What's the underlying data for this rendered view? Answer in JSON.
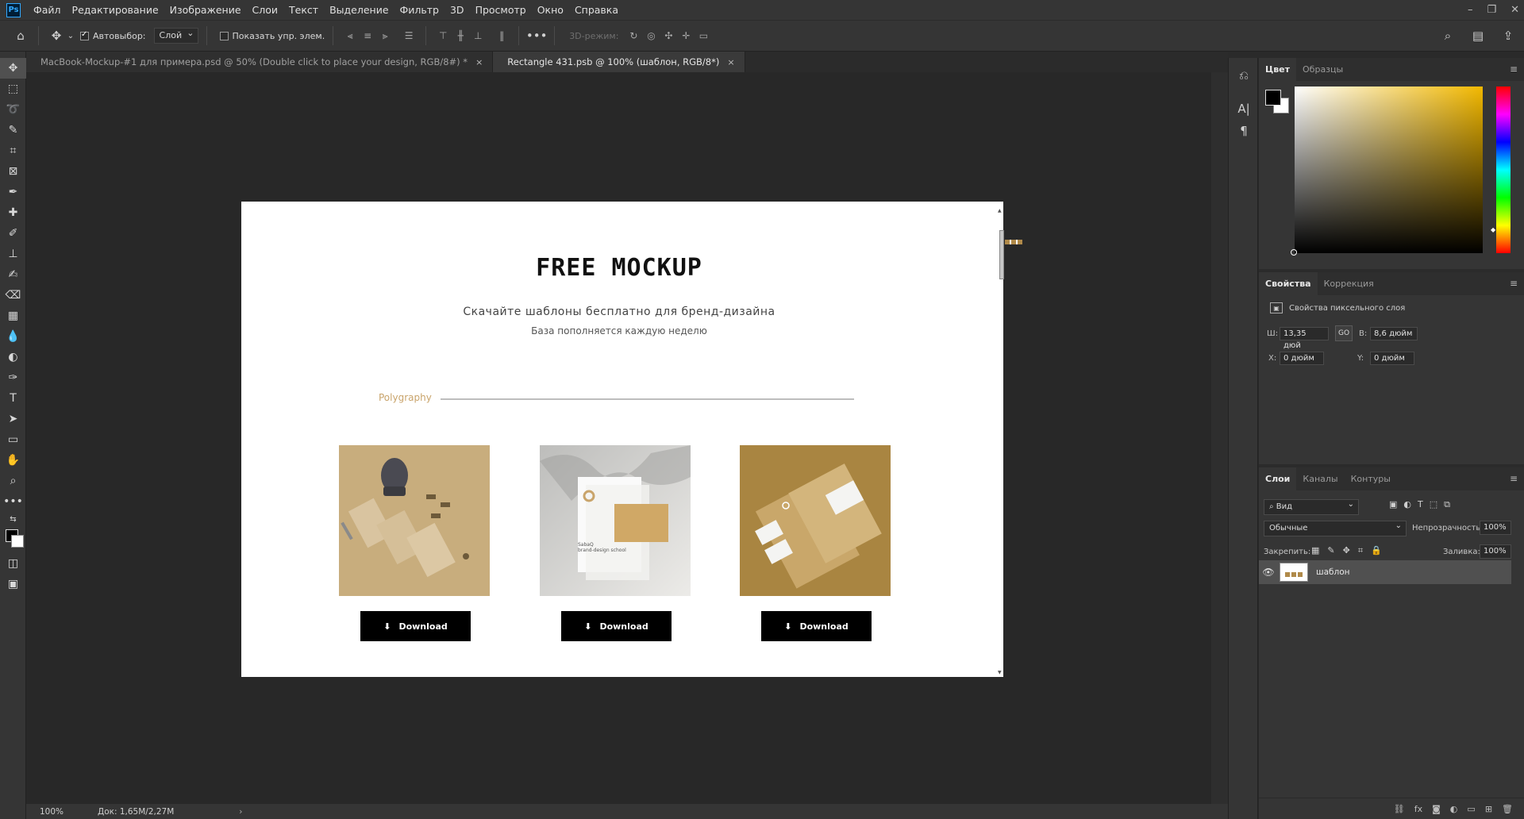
{
  "app": {
    "logo": "Ps"
  },
  "menu": [
    "Файл",
    "Редактирование",
    "Изображение",
    "Слои",
    "Текст",
    "Выделение",
    "Фильтр",
    "3D",
    "Просмотр",
    "Окно",
    "Справка"
  ],
  "options": {
    "auto_select_label": "Автовыбор:",
    "layer_select": "Слой",
    "show_transform_label": "Показать упр. элем.",
    "more": "•••",
    "mode3d": "3D-режим:"
  },
  "tabs": [
    {
      "label": "MacBook-Mockup-#1 для примера.psd @ 50% (Double click to place your design, RGB/8#) *",
      "close": "×"
    },
    {
      "label": "Rectangle 431.psb @ 100% (шаблон, RGB/8*)",
      "close": "×"
    }
  ],
  "status": {
    "zoom": "100%",
    "doc": "Док: 1,65M/2,27M",
    "arrow": "›"
  },
  "document": {
    "title": "FREE MOCKUP",
    "subtitle": "Скачайте шаблоны бесплатно для бренд-дизайна",
    "subtitle2": "База пополняется каждую неделю",
    "category": "Polygraphy",
    "card2_text": "SabaQ\nbrand-design school",
    "download_label": "Download"
  },
  "color_panel": {
    "tabs": [
      "Цвет",
      "Образцы"
    ],
    "menu": "≡"
  },
  "properties_panel": {
    "tabs": [
      "Свойства",
      "Коррекция"
    ],
    "title": "Свойства пиксельного слоя",
    "w_label": "Ш:",
    "w_value": "13,35 дюй",
    "link": "GO",
    "h_label": "В:",
    "h_value": "8,6 дюйм",
    "x_label": "X:",
    "x_value": "0 дюйм",
    "y_label": "Y:",
    "y_value": "0 дюйм"
  },
  "layers_panel": {
    "tabs": [
      "Слои",
      "Каналы",
      "Контуры"
    ],
    "search": "Вид",
    "blend": "Обычные",
    "opacity_label": "Непрозрачность:",
    "opacity_value": "100%",
    "lock_label": "Закрепить:",
    "fill_label": "Заливка:",
    "fill_value": "100%",
    "layer_name": "шаблон"
  },
  "colors": {
    "accent": "#c9a46b",
    "ps_blue": "#31a8ff"
  }
}
